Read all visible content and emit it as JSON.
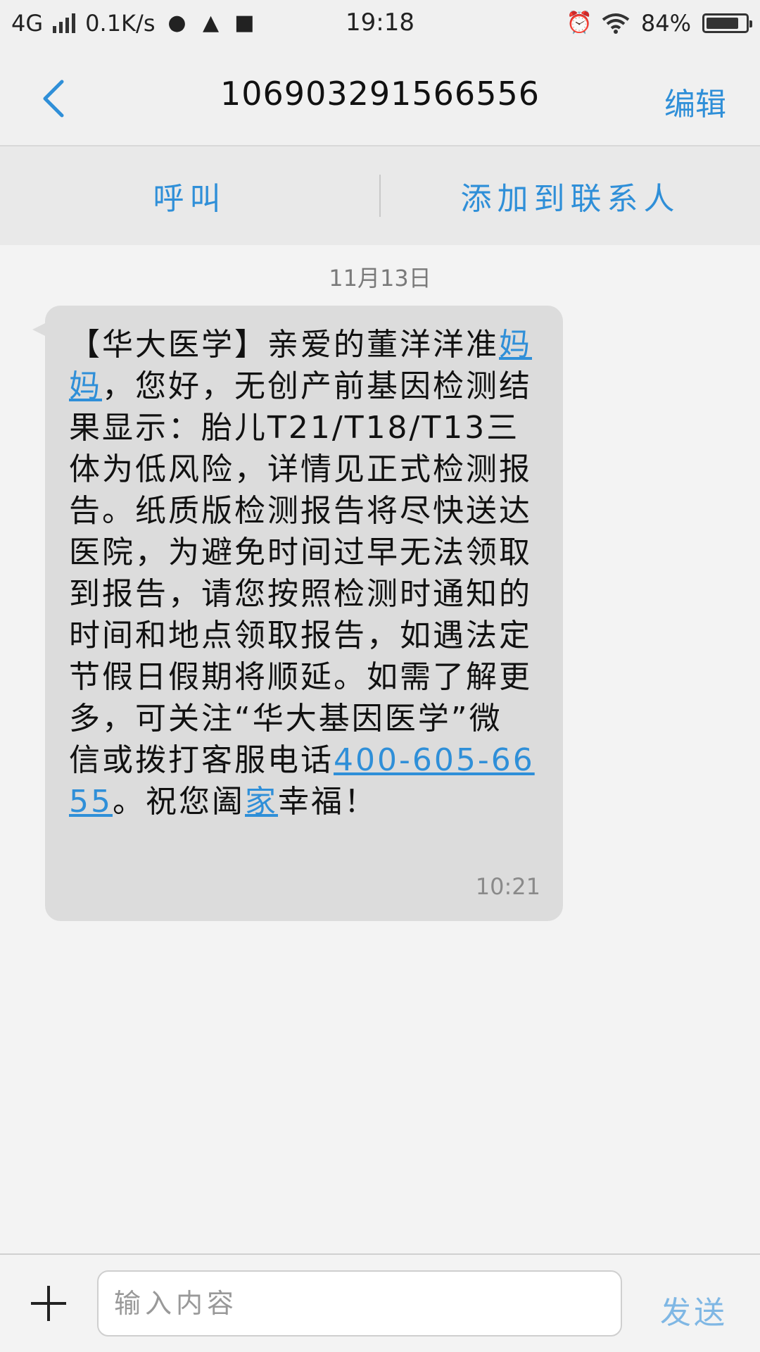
{
  "status_bar": {
    "network": "4G",
    "speed": "0.1K/s",
    "time": "19:18",
    "battery": "84%",
    "battery_level": 0.84
  },
  "header": {
    "title": "106903291566556",
    "edit_label": "编辑"
  },
  "actions": {
    "call_label": "呼叫",
    "add_contact_label": "添加到联系人"
  },
  "conversation": {
    "date": "11月13日",
    "message": {
      "part1": "【华大医学】亲爱的董洋洋准",
      "link1": "妈妈",
      "part2": "，您好，无创产前基因检测结果显示：胎儿T21/T18/T13三体为低风险，详情见正式检测报告。纸质版检测报告将尽快送达医院，为避免时间过早无法领取到报告，请您按照检测时通知的时间和地点领取报告，如遇法定节假日假期将顺延。如需了解更多，可关注“华大基因医学”微信或拨打客服电话",
      "phone": "400-605-6655",
      "part3": "。祝您阖",
      "link2": "家",
      "part4": "幸福！",
      "time": "10:21"
    }
  },
  "input_bar": {
    "placeholder": "输入内容",
    "send_label": "发送"
  },
  "colors": {
    "accent": "#2f8fd8",
    "bubble": "#dcdcdc",
    "background": "#f3f3f3"
  }
}
